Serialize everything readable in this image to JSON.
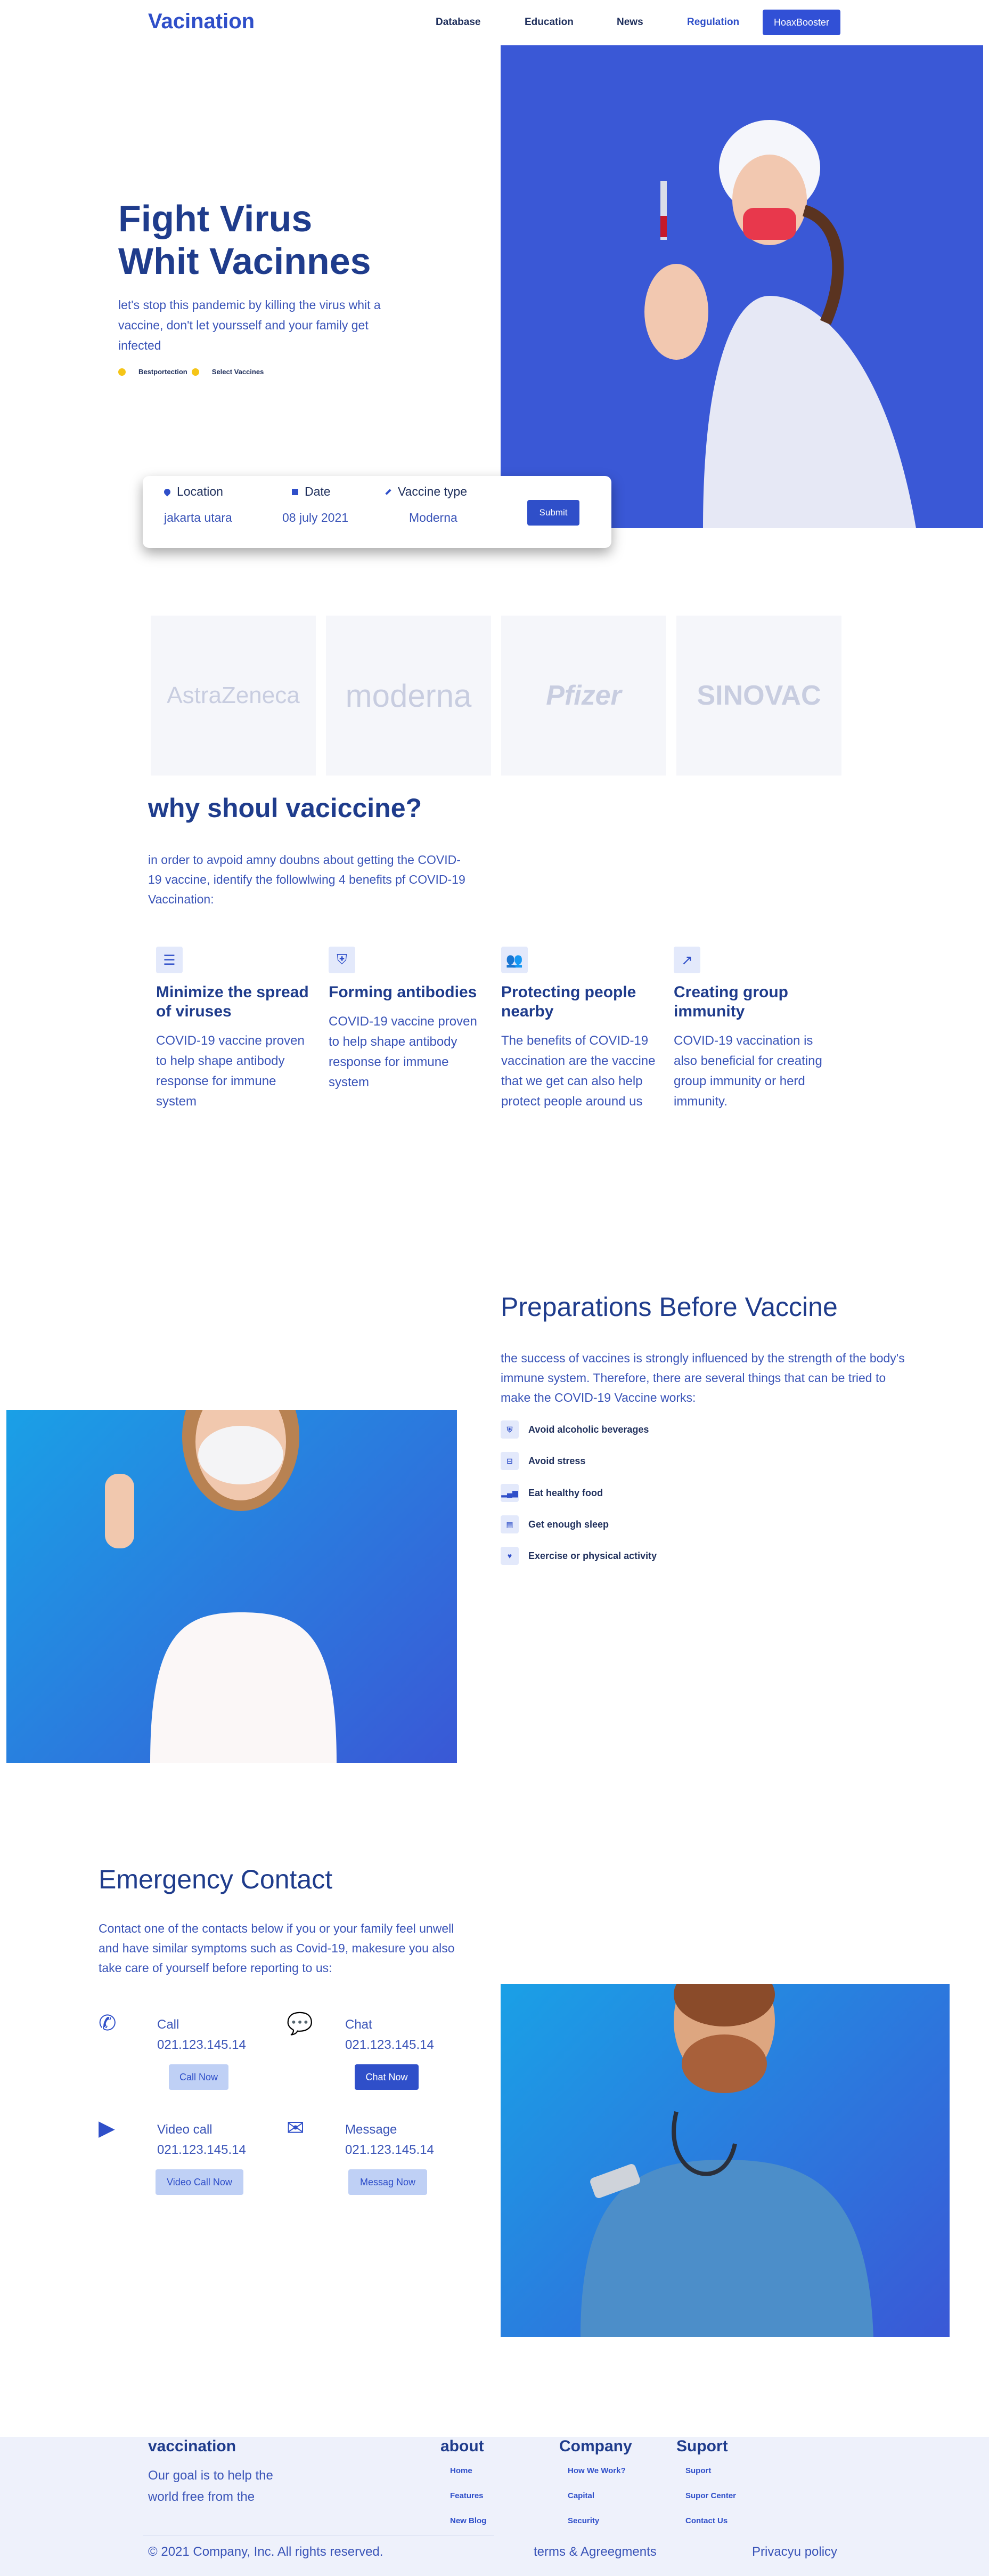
{
  "nav": {
    "brand": "Vacination",
    "links": [
      "Database",
      "Education",
      "News",
      "Regulation"
    ],
    "cta": "HoaxBooster"
  },
  "hero": {
    "title_line1": "Fight Virus",
    "title_line2": "Whit Vacinnes",
    "subtitle": "let's stop this pandemic by killing the virus whit a vaccine, don't let yoursself and your family get infected",
    "tag1": "Bestportection",
    "tag2": "Select Vaccines"
  },
  "search": {
    "location_label": "Location",
    "location_value": "jakarta utara",
    "date_label": "Date",
    "date_value": "08 july 2021",
    "type_label": "Vaccine type",
    "type_value": "Moderna",
    "submit": "Submit"
  },
  "logos": [
    "AstraZeneca",
    "moderna",
    "Pfizer",
    "SINOVAC"
  ],
  "why": {
    "title": "why shoul vaciccine?",
    "text": "in order to avpoid amny doubns about getting the COVID-19 vaccine, identify the followlwing 4 benefits pf COVID-19 Vaccination:",
    "benefits": [
      {
        "icon": "list-icon",
        "title": "Minimize the spread of viruses",
        "text": "COVID-19 vaccine proven to help shape antibody response for immune system"
      },
      {
        "icon": "shield-icon",
        "title": "Forming antibodies",
        "text": "COVID-19 vaccine proven to help shape antibody response for immune system"
      },
      {
        "icon": "people-icon",
        "title": "Protecting people nearby",
        "text": "The benefits of COVID-19 vaccination are the vaccine that we get can also help protect people around us"
      },
      {
        "icon": "trend-icon",
        "title": "Creating group immunity",
        "text": "COVID-19 vaccination is also beneficial for creating group immunity or herd immunity."
      }
    ]
  },
  "prep": {
    "title": "Preparations Before Vaccine",
    "text": "the success of vaccines is strongly influenced by the strength of the body's immune system. Therefore, there are several things that can be tried to make the COVID-19 Vaccine works:",
    "items": [
      "Avoid alcoholic beverages",
      "Avoid stress",
      "Eat healthy food",
      "Get enough sleep",
      "Exercise or physical activity"
    ]
  },
  "emergency": {
    "title": "Emergency Contact",
    "text": "Contact one of the contacts below if you or your family feel unwell and have similar symptoms such as Covid-19, makesure you also take care of yourself before reporting to us:",
    "contacts": [
      {
        "label": "Call",
        "number": "021.123.145.14",
        "button": "Call Now"
      },
      {
        "label": "Chat",
        "number": "021.123.145.14",
        "button": "Chat Now"
      },
      {
        "label": "Video call",
        "number": "021.123.145.14",
        "button": "Video Call Now"
      },
      {
        "label": "Message",
        "number": "021.123.145.14",
        "button": "Messag Now"
      }
    ]
  },
  "footer": {
    "brand": "vaccination",
    "desc": "Our goal is to help the world free from the",
    "cols": [
      {
        "title": "about",
        "links": [
          "Home",
          "Features",
          "New Blog"
        ]
      },
      {
        "title": "Company",
        "links": [
          "How We Work?",
          "Capital",
          "Security"
        ]
      },
      {
        "title": "Suport",
        "links": [
          "Suport",
          "Supor Center",
          "Contact Us"
        ]
      }
    ],
    "copyright": "© 2021 Company, Inc. All rights reserved.",
    "terms": "terms & Agreegments",
    "privacy": "Privacyu policy"
  }
}
